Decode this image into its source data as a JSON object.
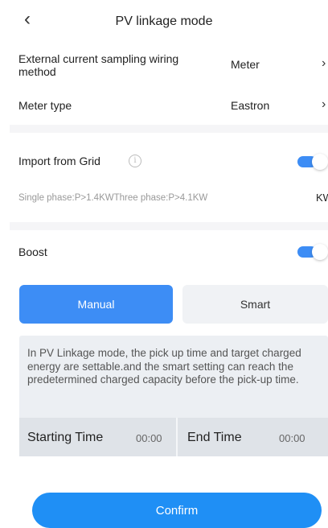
{
  "header": {
    "back_icon": "chevron-left-icon",
    "title": "PV linkage mode"
  },
  "wiring": {
    "label": "External current sampling wiring method",
    "value": "Meter"
  },
  "meter": {
    "label": "Meter type",
    "value": "Eastron"
  },
  "grid": {
    "label": "Import from Grid",
    "info_icon": "info-icon",
    "info_glyph": "i",
    "enabled": true,
    "hint": "Single phase:P>1.4KWThree phase:P>4.1KW",
    "unit": "KW"
  },
  "boost": {
    "label": "Boost",
    "enabled": true
  },
  "modes": {
    "manual": "Manual",
    "smart": "Smart",
    "selected": "Manual"
  },
  "description": "In PV Linkage mode, the pick up time and target charged energy are settable.and the smart setting can reach the predetermined charged capacity before the pick-up time.",
  "times": {
    "start_label": "Starting Time",
    "start_value": "00:00",
    "end_label": "End Time",
    "end_value": "00:00"
  },
  "confirm": "Confirm",
  "colors": {
    "accent": "#3d8df5",
    "confirm": "#1f8ff5"
  }
}
